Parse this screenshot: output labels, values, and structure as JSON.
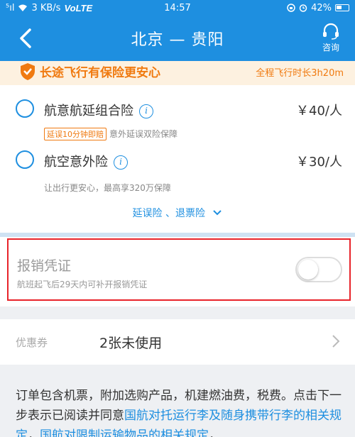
{
  "status_bar": {
    "signal": "⁵ıl",
    "speed": "3 KB/s",
    "volte": "VoLTE",
    "time": "14:57",
    "battery": "42%"
  },
  "nav": {
    "title": "北京 — 贵阳",
    "consult_label": "咨询"
  },
  "banner": {
    "text": "长途飞行有保险更安心",
    "right_text": "全程飞行时长3h20m"
  },
  "insurance": {
    "items": [
      {
        "name": "航意航延组合险",
        "price": "￥40/人",
        "tag": "延误10分钟即赔",
        "desc": "意外延误双险保障"
      },
      {
        "name": "航空意外险",
        "price": "￥30/人",
        "desc": "让出行更安心，最高享320万保障"
      }
    ],
    "more_link": "延误险 、退票险"
  },
  "receipt": {
    "title": "报销凭证",
    "subtitle": "航班起飞后29天内可补开报销凭证",
    "enabled": false
  },
  "coupon": {
    "label": "优惠券",
    "value": "2张未使用"
  },
  "notes": {
    "line1": "订单包含机票，附加选购产品，机建燃油费，税费。",
    "line2_prefix": "点击下一步表示已阅读并同意",
    "link1": "国航对托运行李及随身携带行李的相关规定",
    "separator": "，",
    "link2": "国航对限制运输物品的相关规定",
    "suffix": "，"
  },
  "colors": {
    "brand_blue": "#1e8fe0",
    "orange": "#f07a10",
    "highlight_red": "#e8232a"
  }
}
